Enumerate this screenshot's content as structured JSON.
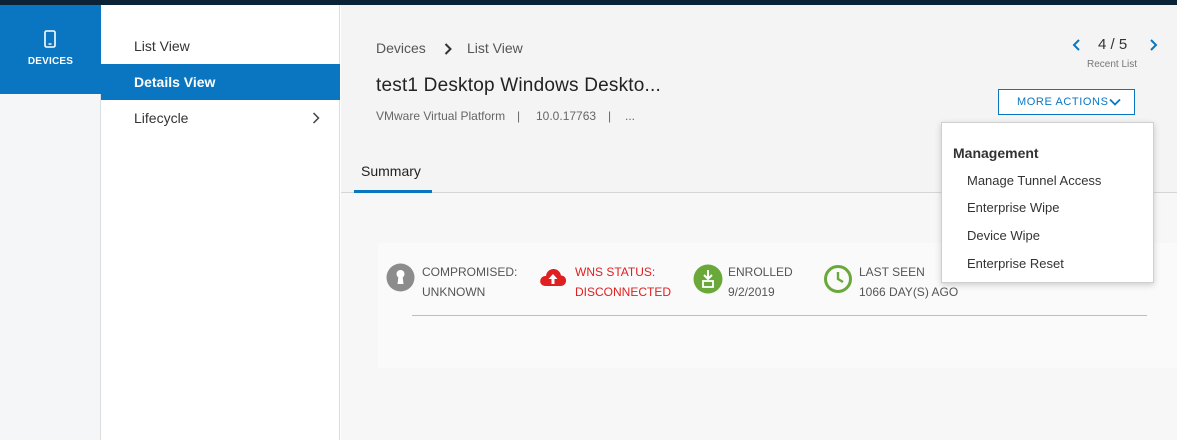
{
  "rail": {
    "devices_label": "DEVICES",
    "devices_icon": "phone-icon"
  },
  "submenu": {
    "items": [
      {
        "label": "List View"
      },
      {
        "label": "Details View"
      },
      {
        "label": "Lifecycle"
      }
    ]
  },
  "breadcrumb": {
    "root": "Devices",
    "current": "List View"
  },
  "device": {
    "title": "test1 Desktop Windows Deskto...",
    "platform": "VMware Virtual Platform",
    "sep": "|",
    "version": "10.0.17763",
    "more": "..."
  },
  "pager": {
    "count": "4 / 5",
    "label": "Recent List"
  },
  "actions": {
    "more_label": "MORE ACTIONS"
  },
  "tabs": {
    "summary": "Summary"
  },
  "status": [
    {
      "line1": "COMPROMISED:",
      "line2": "UNKNOWN",
      "icon": "keyhole-icon",
      "color": "#8c8c8c"
    },
    {
      "line1": "WNS STATUS:",
      "line2": "DISCONNECTED",
      "icon": "cloud-upload-icon",
      "color": "#e02020"
    },
    {
      "line1": "ENROLLED",
      "line2": "9/2/2019",
      "icon": "enrolled-icon",
      "color": "#6aa83a"
    },
    {
      "line1": "LAST SEEN",
      "line2": "1066 DAY(S) AGO",
      "icon": "clock-icon",
      "color": "#6aa83a"
    }
  ],
  "dropdown": {
    "heading": "Management",
    "items": [
      {
        "label": "Manage Tunnel Access"
      },
      {
        "label": "Enterprise Wipe"
      },
      {
        "label": "Device Wipe"
      },
      {
        "label": "Enterprise Reset"
      }
    ]
  },
  "colors": {
    "accent": "#0a76c1",
    "topbar": "#0b2336",
    "error": "#e02020",
    "success": "#6aa83a"
  }
}
